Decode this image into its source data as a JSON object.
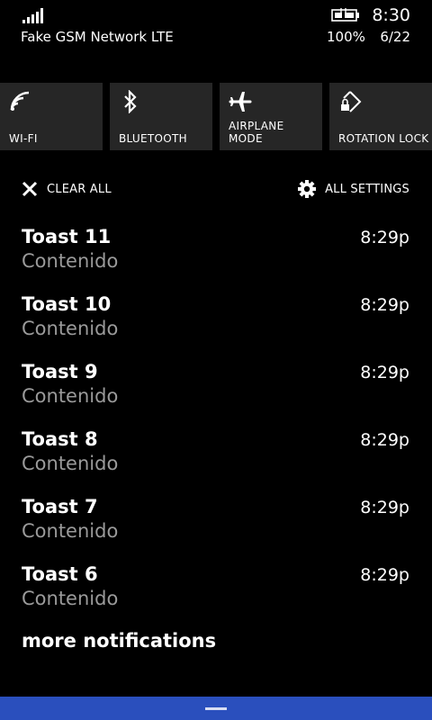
{
  "status_bar": {
    "carrier": "Fake GSM Network LTE",
    "time": "8:30",
    "battery_percent": "100%",
    "date": "6/22",
    "signal_icon": "signal-bars-icon",
    "battery_icon": "battery-charging-icon"
  },
  "quick_actions": [
    {
      "label": "WI-FI",
      "icon": "wifi-icon"
    },
    {
      "label": "BLUETOOTH",
      "icon": "bluetooth-icon"
    },
    {
      "label": "AIRPLANE\nMODE",
      "icon": "airplane-icon"
    },
    {
      "label": "ROTATION LOCK",
      "icon": "rotation-lock-icon"
    }
  ],
  "actions": {
    "clear_all": "CLEAR ALL",
    "all_settings": "ALL SETTINGS"
  },
  "notifications": [
    {
      "title": "Toast 11",
      "body": "Contenido",
      "time": "8:29p"
    },
    {
      "title": "Toast 10",
      "body": "Contenido",
      "time": "8:29p"
    },
    {
      "title": "Toast 9",
      "body": "Contenido",
      "time": "8:29p"
    },
    {
      "title": "Toast 8",
      "body": "Contenido",
      "time": "8:29p"
    },
    {
      "title": "Toast 7",
      "body": "Contenido",
      "time": "8:29p"
    },
    {
      "title": "Toast 6",
      "body": "Contenido",
      "time": "8:29p"
    }
  ],
  "more_notifications": "more notifications",
  "colors": {
    "background": "#000000",
    "tile": "#262626",
    "secondary_text": "#9a9a9a",
    "accent_bar": "#2a4fbd"
  }
}
